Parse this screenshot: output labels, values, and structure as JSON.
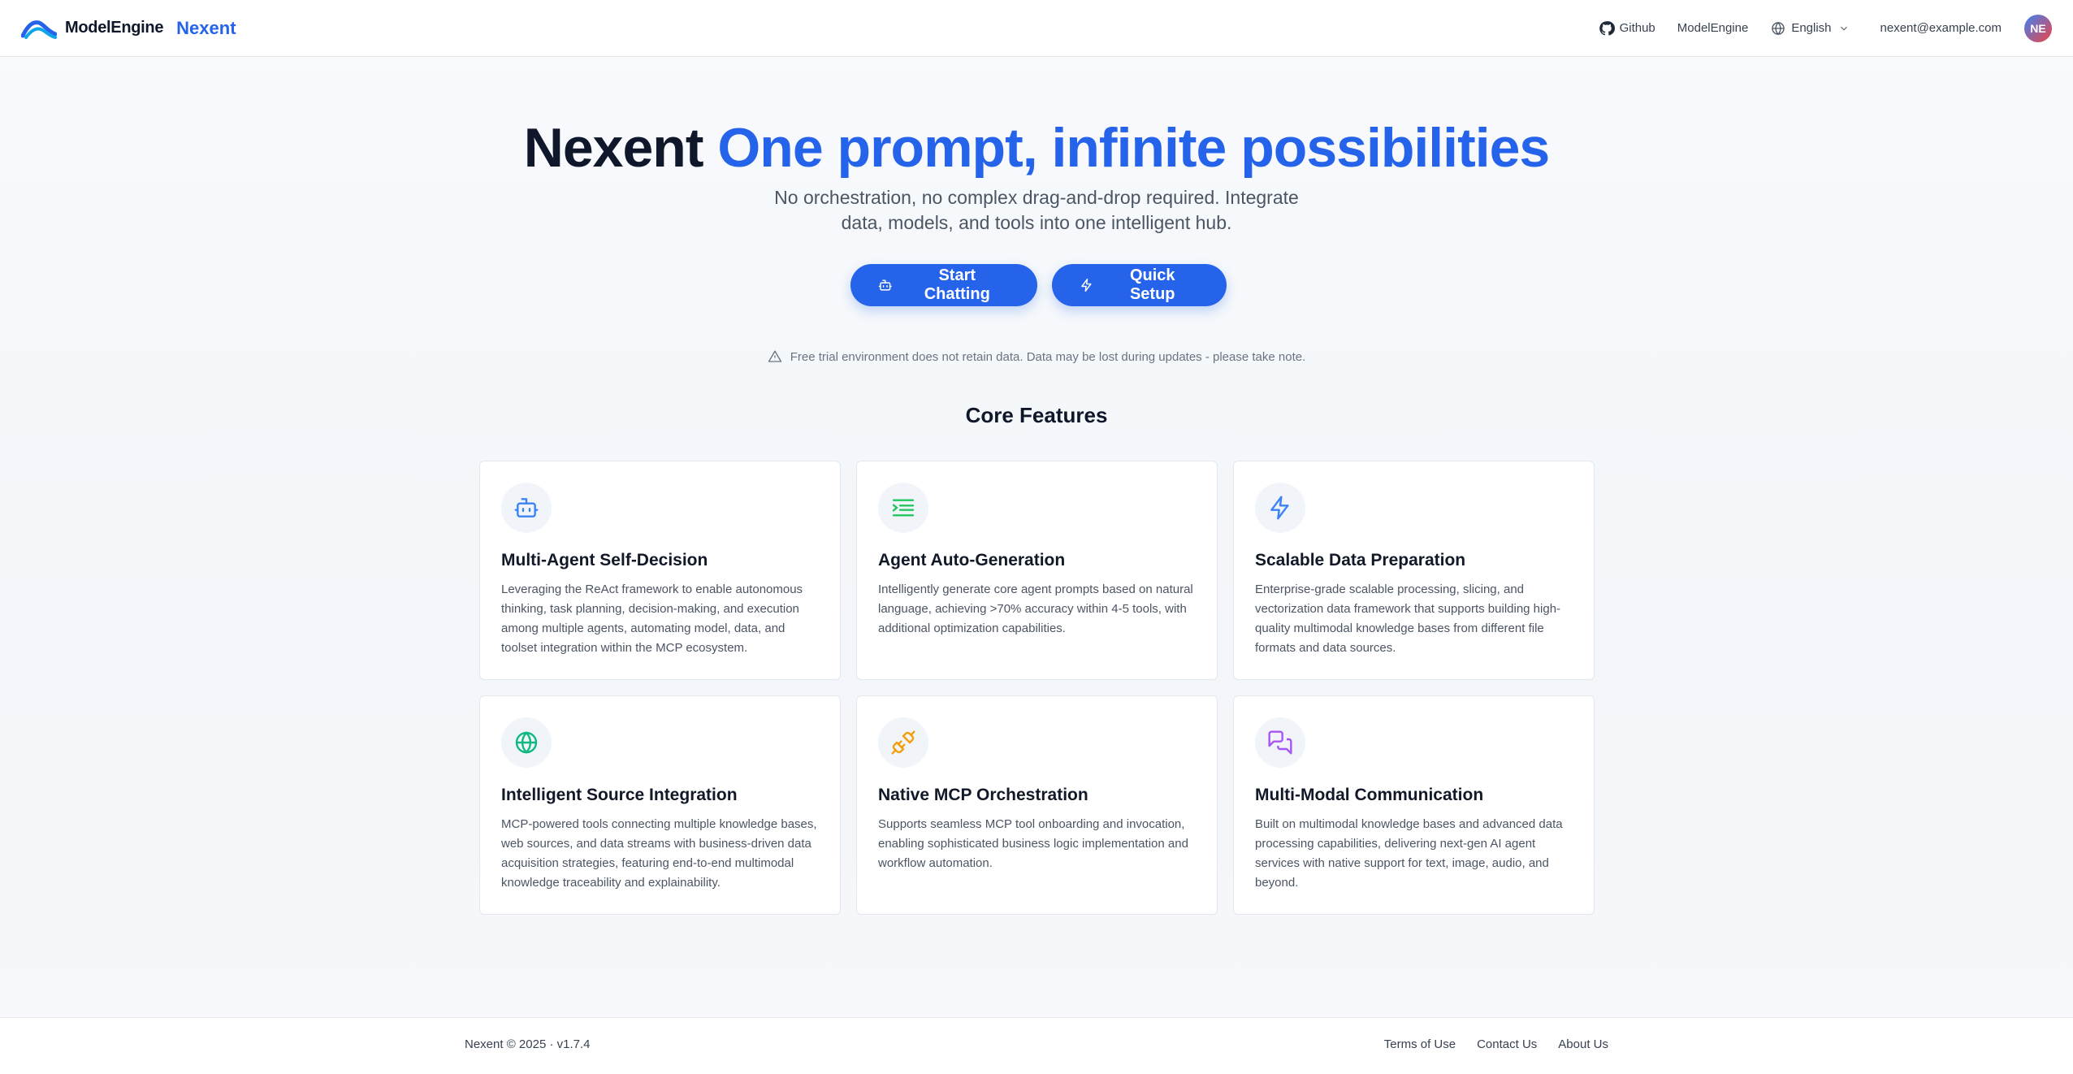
{
  "header": {
    "brand_name": "ModelEngine",
    "product_name": "Nexent",
    "nav": {
      "github": "Github",
      "modelengine": "ModelEngine",
      "language": "English"
    },
    "user_email": "nexent@example.com",
    "avatar_initials": "NE",
    "icons": [
      "github-icon",
      "globe-icon",
      "chevron-down-icon"
    ]
  },
  "hero": {
    "title_prefix": "Nexent",
    "title_highlight": "One prompt, infinite possibilities",
    "subtitle": "No orchestration, no complex drag-and-drop required. Integrate data, models, and tools into one intelligent hub.",
    "buttons": {
      "start_chatting": "Start Chatting",
      "quick_setup": "Quick Setup"
    },
    "notice": "Free trial environment does not retain data. Data may be lost during updates - please take note."
  },
  "features": {
    "title": "Core Features",
    "items": [
      {
        "title": "Multi-Agent Self-Decision",
        "description": "Leveraging the ReAct framework to enable autonomous thinking, task planning, decision-making, and execution among multiple agents, automating model, data, and toolset integration within the MCP ecosystem.",
        "icon": "bot-icon",
        "color": "#3b82f6"
      },
      {
        "title": "Agent Auto-Generation",
        "description": "Intelligently generate core agent prompts based on natural language, achieving >70% accuracy within 4-5 tools, with additional optimization capabilities.",
        "icon": "list-icon",
        "color": "#22c55e"
      },
      {
        "title": "Scalable Data Preparation",
        "description": "Enterprise-grade scalable processing, slicing, and vectorization data framework that supports building high-quality multimodal knowledge bases from different file formats and data sources.",
        "icon": "lightning-icon",
        "color": "#3b82f6"
      },
      {
        "title": "Intelligent Source Integration",
        "description": "MCP-powered tools connecting multiple knowledge bases, web sources, and data streams with business-driven data acquisition strategies, featuring end-to-end multimodal knowledge traceability and explainability.",
        "icon": "globe-icon",
        "color": "#10b981"
      },
      {
        "title": "Native MCP Orchestration",
        "description": "Supports seamless MCP tool onboarding and invocation, enabling sophisticated business logic implementation and workflow automation.",
        "icon": "plug-icon",
        "color": "#f59e0b"
      },
      {
        "title": "Multi-Modal Communication",
        "description": "Built on multimodal knowledge bases and advanced data processing capabilities, delivering next-gen AI agent services with native support for text, image, audio, and beyond.",
        "icon": "chat-bubbles-icon",
        "color": "#a855f7"
      }
    ]
  },
  "footer": {
    "copyright": "Nexent © 2025 · v1.7.4",
    "links": {
      "terms": "Terms of Use",
      "contact": "Contact Us",
      "about": "About Us"
    }
  },
  "colors": {
    "accent": "#2563eb",
    "text_dark": "#0f172a",
    "text_muted": "#4b5563"
  }
}
